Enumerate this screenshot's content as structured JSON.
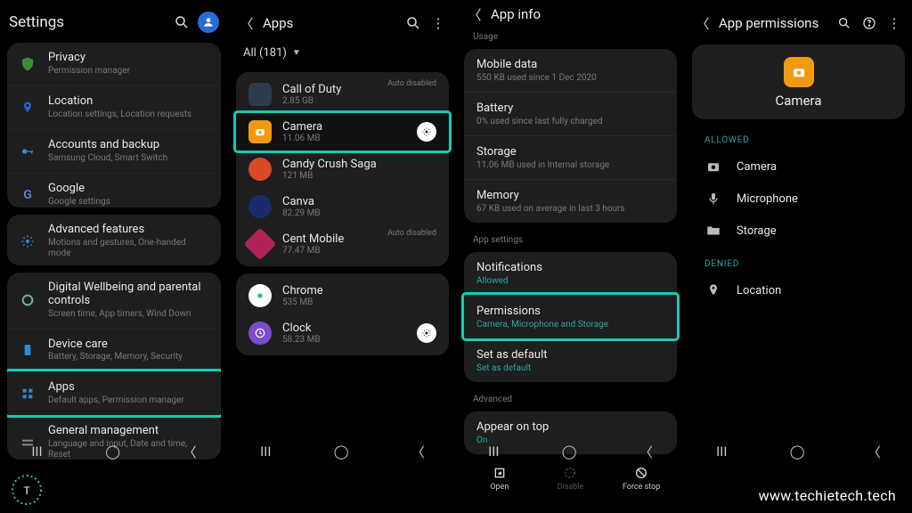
{
  "panel1": {
    "title": "Settings",
    "groups": [
      [
        {
          "icon": "shield",
          "label": "Privacy",
          "sub": "Permission manager"
        },
        {
          "icon": "pin",
          "label": "Location",
          "sub": "Location settings, Location requests"
        },
        {
          "icon": "key",
          "label": "Accounts and backup",
          "sub": "Samsung Cloud, Smart Switch"
        },
        {
          "icon": "g",
          "label": "Google",
          "sub": "Google settings"
        }
      ],
      [
        {
          "icon": "gear",
          "label": "Advanced features",
          "sub": "Motions and gestures, One-handed mode"
        }
      ],
      [
        {
          "icon": "wellbeing",
          "label": "Digital Wellbeing and parental controls",
          "sub": "Screen time, App timers, Wind Down"
        },
        {
          "icon": "device",
          "label": "Device care",
          "sub": "Battery, Storage, Memory, Security"
        },
        {
          "icon": "apps",
          "label": "Apps",
          "sub": "Default apps, Permission manager",
          "highlight": true
        },
        {
          "icon": "general",
          "label": "General management",
          "sub": "Language and input, Date and time, Reset"
        }
      ]
    ]
  },
  "panel2": {
    "title": "Apps",
    "filter": "All (181)",
    "groups": [
      [
        {
          "label": "Call of Duty",
          "sub": "2.85 GB",
          "iconColor": "#2d3b4d",
          "auto": true
        },
        {
          "label": "Camera",
          "sub": "11.06 MB",
          "iconColor": "#f29a0f",
          "gear": true,
          "highlight": true
        },
        {
          "label": "Candy Crush Saga",
          "sub": "121 MB",
          "iconColor": "#d94a2a"
        },
        {
          "label": "Canva",
          "sub": "82.29 MB",
          "iconColor": "#1a2a6b"
        },
        {
          "label": "Cent Mobile",
          "sub": "77.47 MB",
          "iconColor": "#b0235a",
          "auto": true
        }
      ],
      [
        {
          "label": "Chrome",
          "sub": "535 MB",
          "iconColor": "#fff"
        },
        {
          "label": "Clock",
          "sub": "58.23 MB",
          "iconColor": "#7c4cc9",
          "gear": true
        }
      ]
    ]
  },
  "panel3": {
    "title": "App info",
    "usage_title": "Usage",
    "usage": [
      {
        "label": "Mobile data",
        "sub": "550 KB used since 1 Dec 2020"
      },
      {
        "label": "Battery",
        "sub": "0% used since last fully charged"
      },
      {
        "label": "Storage",
        "sub": "11.06 MB used in Internal storage"
      },
      {
        "label": "Memory",
        "sub": "67 KB used on average in last 3 hours"
      }
    ],
    "settings_title": "App settings",
    "settings": [
      {
        "label": "Notifications",
        "sub": "Allowed",
        "link": true
      },
      {
        "label": "Permissions",
        "sub": "Camera, Microphone and Storage",
        "link": true,
        "highlight": true
      },
      {
        "label": "Set as default",
        "sub": "Set as default",
        "link": true
      }
    ],
    "advanced_title": "Advanced",
    "advanced": [
      {
        "label": "Appear on top",
        "sub": "On",
        "link": true
      }
    ],
    "buttons": [
      {
        "label": "Open",
        "icon": "open",
        "enabled": true
      },
      {
        "label": "Disable",
        "icon": "disable",
        "enabled": false
      },
      {
        "label": "Force stop",
        "icon": "stop",
        "enabled": true
      }
    ]
  },
  "panel4": {
    "title": "App permissions",
    "app_name": "Camera",
    "allowed_title": "ALLOWED",
    "allowed": [
      {
        "icon": "camera",
        "label": "Camera"
      },
      {
        "icon": "mic",
        "label": "Microphone"
      },
      {
        "icon": "folder",
        "label": "Storage"
      }
    ],
    "denied_title": "DENIED",
    "denied": [
      {
        "icon": "pin",
        "label": "Location"
      }
    ]
  },
  "footer": "www.techietech.tech"
}
